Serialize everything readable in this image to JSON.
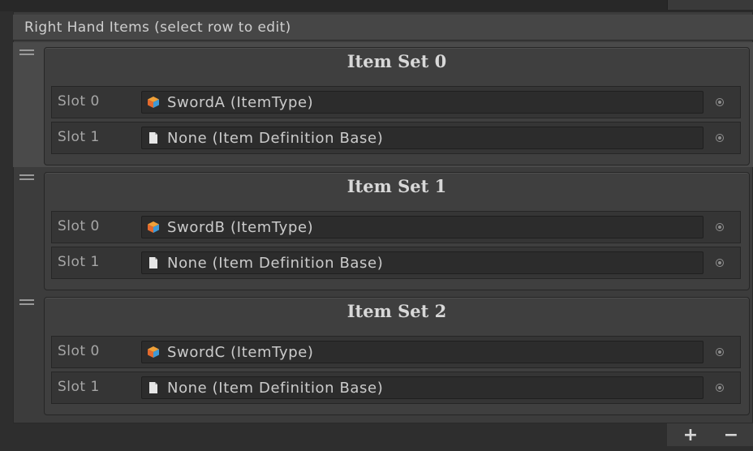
{
  "list": {
    "header": "Right Hand Items (select row to edit)"
  },
  "item_sets": [
    {
      "title": "Item Set 0",
      "slots": [
        {
          "label": "Slot 0",
          "value": "SwordA (ItemType)",
          "icon": "item-type-cube-icon"
        },
        {
          "label": "Slot 1",
          "value": "None (Item Definition Base)",
          "icon": "document-icon"
        }
      ]
    },
    {
      "title": "Item Set 1",
      "slots": [
        {
          "label": "Slot 0",
          "value": "SwordB (ItemType)",
          "icon": "item-type-cube-icon"
        },
        {
          "label": "Slot 1",
          "value": "None (Item Definition Base)",
          "icon": "document-icon"
        }
      ]
    },
    {
      "title": "Item Set 2",
      "slots": [
        {
          "label": "Slot 0",
          "value": "SwordC (ItemType)",
          "icon": "item-type-cube-icon"
        },
        {
          "label": "Slot 1",
          "value": "None (Item Definition Base)",
          "icon": "document-icon"
        }
      ]
    }
  ],
  "footer": {
    "add_label": "+",
    "remove_label": "−"
  },
  "colors": {
    "panel_bg": "#3c3c3c",
    "field_bg": "#2c2c2c",
    "text": "#cbcbcb"
  }
}
